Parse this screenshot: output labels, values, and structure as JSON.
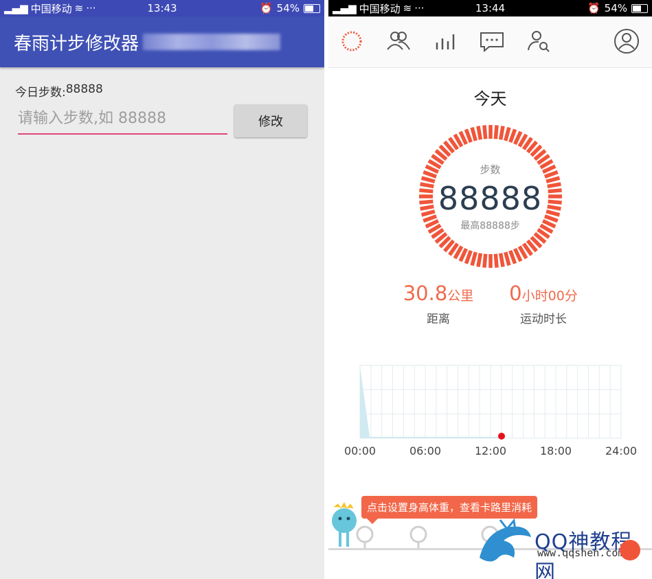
{
  "left": {
    "status": {
      "carrier": "中国移动",
      "time": "13:43",
      "battery": "54%"
    },
    "app_title": "春雨计步修改器",
    "steps_label": "今日步数:",
    "steps_value": "88888",
    "input_placeholder": "请输入步数,如 88888",
    "modify_button": "修改"
  },
  "right": {
    "status": {
      "carrier": "中国移动",
      "time": "13:44",
      "battery": "54%"
    },
    "nav_icons": [
      "ring-icon",
      "friends-icon",
      "stats-icon",
      "message-icon",
      "user-search-icon",
      "profile-icon"
    ],
    "today": "今天",
    "steps_caption": "步数",
    "steps_value": "88888",
    "steps_max": "最高88888步",
    "distance": {
      "value": "30.8",
      "unit": "公里",
      "label": "距离"
    },
    "duration": {
      "value": "0",
      "unit": "小时00分",
      "label": "运动时长"
    },
    "chart": {
      "x_ticks": [
        "00:00",
        "06:00",
        "12:00",
        "18:00",
        "24:00"
      ],
      "marker_time": "12:00"
    },
    "tooltip": "点击设置身高体重，查看卡路里消耗",
    "watermark": "QQ神教程网",
    "watermark_url": "www.qqshen.com"
  },
  "colors": {
    "primary": "#3f51b5",
    "accent": "#e0457b",
    "ring": "#f0553a",
    "stat": "#f06a4c"
  }
}
